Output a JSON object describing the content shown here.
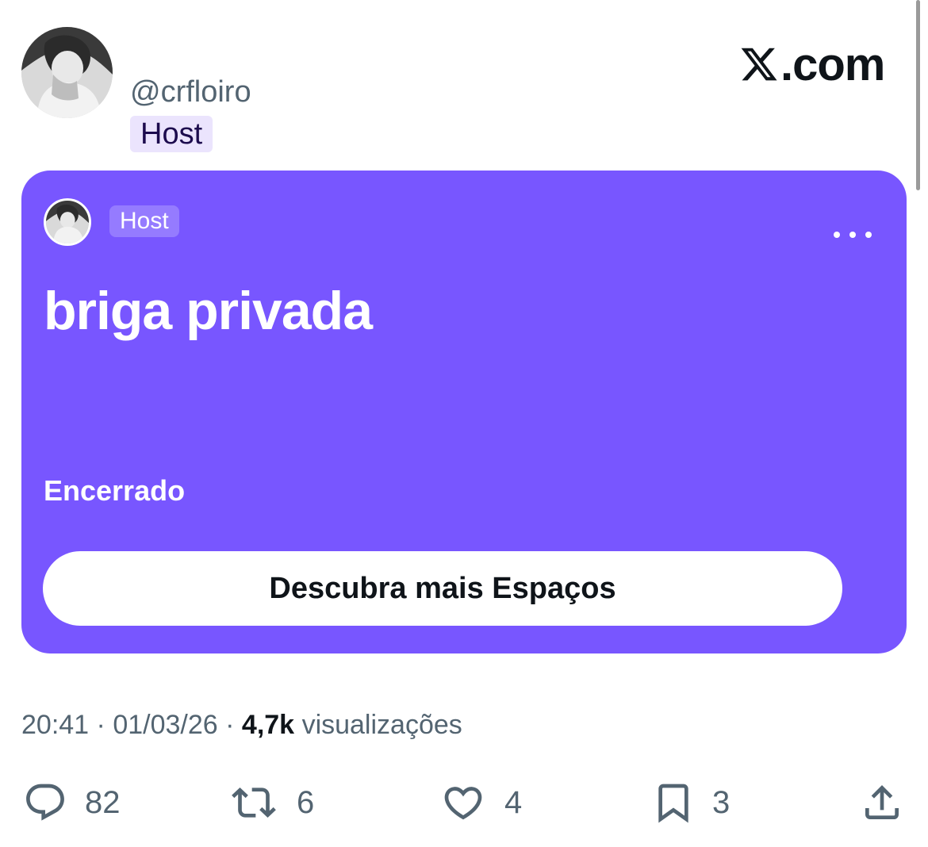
{
  "tweet": {
    "handle": "@crfloiro",
    "host_badge": "Host",
    "brand": {
      "icon": "x-logo-icon",
      "suffix": ".com"
    }
  },
  "space": {
    "host_badge": "Host",
    "title": "briga privada",
    "status": "Encerrado",
    "discover_label": "Descubra mais Espaços",
    "more_icon": "more-horizontal-icon",
    "background": "#7856ff"
  },
  "meta": {
    "time": "20:41",
    "separator": "·",
    "date": "01/03/26",
    "views_count": "4,7k",
    "views_label": "visualizações"
  },
  "actions": {
    "replies": {
      "icon": "reply-icon",
      "count": "82"
    },
    "reposts": {
      "icon": "repost-icon",
      "count": "6"
    },
    "likes": {
      "icon": "heart-icon",
      "count": "4"
    },
    "bookmarks": {
      "icon": "bookmark-icon",
      "count": "3"
    },
    "share": {
      "icon": "share-icon"
    }
  },
  "colors": {
    "accent": "#7856ff",
    "badge_bg": "#ebe4fd",
    "badge_text": "#1d0c4e",
    "muted_text": "#536471",
    "primary_text": "#0f1419"
  }
}
